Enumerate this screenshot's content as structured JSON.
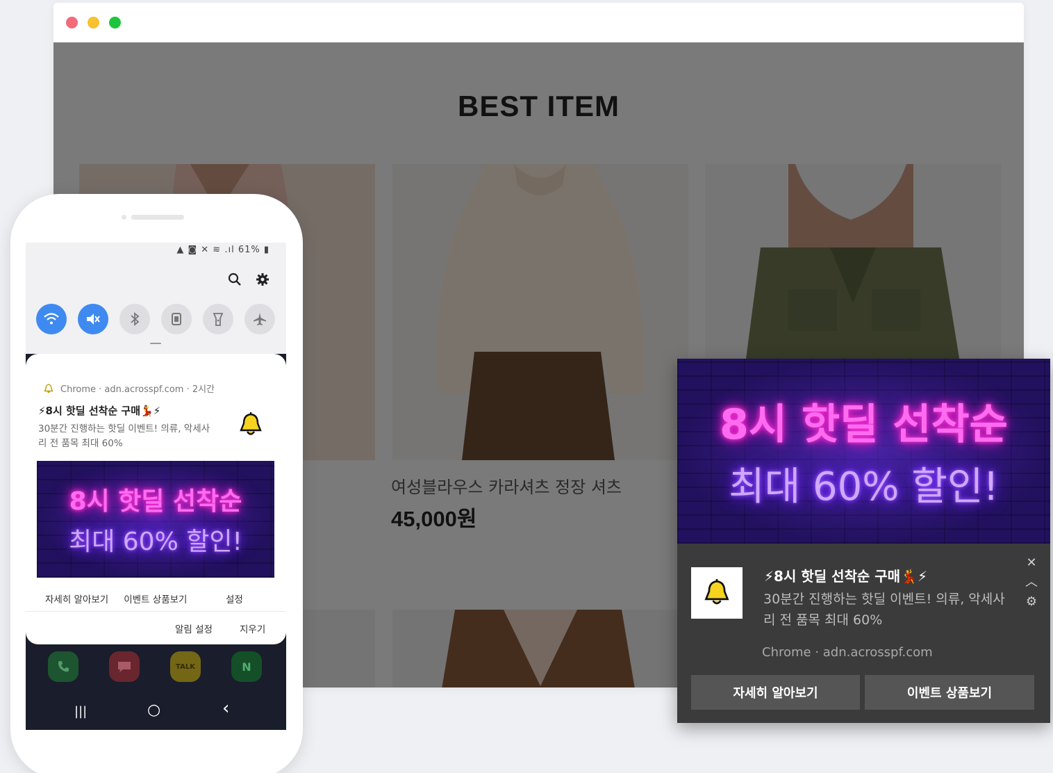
{
  "browser": {
    "section_title": "BEST ITEM",
    "product": {
      "name": "여성블라우스 카라셔츠 정장 셔츠",
      "price": "45,000원"
    }
  },
  "phone": {
    "status_bar": "▲ ◙ ✕ ≋ .ıl 61% ▮",
    "quick_toggles": [
      {
        "icon": "wifi-icon",
        "on": true
      },
      {
        "icon": "mute-icon",
        "on": true
      },
      {
        "icon": "bluetooth-icon",
        "on": false
      },
      {
        "icon": "rotation-icon",
        "on": false
      },
      {
        "icon": "flashlight-icon",
        "on": false
      },
      {
        "icon": "airplane-icon",
        "on": false
      }
    ],
    "notification": {
      "source": "Chrome · adn.acrosspf.com · 2시간",
      "title": "⚡8시 핫딜 선착순 구매💃⚡",
      "body": "30분간 진행하는 핫딜 이벤트! 의류, 악세사리 전 품목 최대 60%",
      "banner_line1": "8시 핫딜 선착순",
      "banner_line2": "최대 60% 할인!",
      "action_learn_more": "자세히 알아보기",
      "action_event_products": "이벤트 상품보기",
      "action_settings": "설정",
      "footer_notification_settings": "알림 설정",
      "footer_clear": "지우기"
    },
    "dock": [
      {
        "icon": "phone-icon",
        "color": "#1e8c3a"
      },
      {
        "icon": "message-icon",
        "color": "#c3343c"
      },
      {
        "icon": "kakaotalk-icon",
        "label": "TALK",
        "color": "#f2d300"
      },
      {
        "icon": "naver-icon",
        "label": "N",
        "color": "#18a53b"
      }
    ],
    "navbar": {
      "recents": "|||",
      "home": "○",
      "back": "‹"
    }
  },
  "desktop_notification": {
    "banner_line1": "8시 핫딜 선착순",
    "banner_line2": "최대 60% 할인!",
    "title": "⚡8시 핫딜 선착순 구매💃⚡",
    "body": "30분간 진행하는 핫딜 이벤트! 의류, 악세사리 전 품목 최대 60%",
    "source": "Chrome · adn.acrosspf.com",
    "button_learn_more": "자세히 알아보기",
    "button_event_products": "이벤트 상품보기",
    "close": "✕",
    "collapse": "︿",
    "settings": "⚙"
  },
  "colors": {
    "toggle_on": "#3e8af0",
    "neon_pink": "#ff6cf0",
    "neon_violet": "#cfa8ff",
    "desktop_bg": "#3b3b3b"
  }
}
